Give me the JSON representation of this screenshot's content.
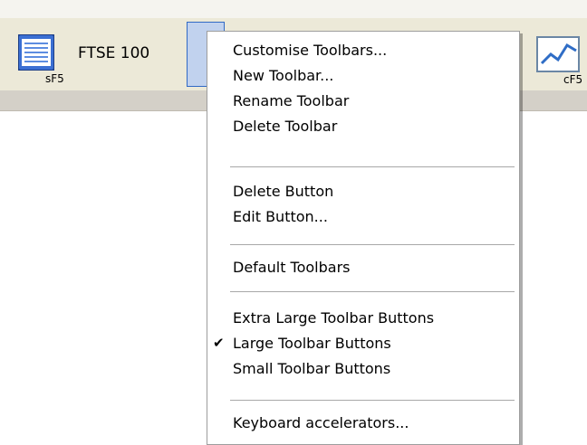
{
  "toolbar": {
    "list_button": {
      "title": "FTSE 100",
      "shortcut": "sF5",
      "icon": "list-icon"
    },
    "chart_button": {
      "shortcut": "cF5",
      "icon": "line-chart-icon"
    }
  },
  "menu": {
    "items": [
      {
        "label": "Customise Toolbars...",
        "checked": false
      },
      {
        "label": "New Toolbar...",
        "checked": false
      },
      {
        "label": "Rename Toolbar",
        "checked": false
      },
      {
        "label": "Delete Toolbar",
        "checked": false
      },
      {
        "label": "Delete Button",
        "checked": false
      },
      {
        "label": "Edit Button...",
        "checked": false
      },
      {
        "label": "Default Toolbars",
        "checked": false
      },
      {
        "label": "Extra Large Toolbar Buttons",
        "checked": false
      },
      {
        "label": "Large Toolbar Buttons",
        "checked": true
      },
      {
        "label": "Small Toolbar Buttons",
        "checked": false
      },
      {
        "label": "Keyboard accelerators...",
        "checked": false
      }
    ]
  },
  "colors": {
    "toolbar_bg": "#ece9d8",
    "toolbar_bottom": "#d4d0c8",
    "menu_bg": "#ffffff",
    "selection_border": "#316ac5"
  }
}
